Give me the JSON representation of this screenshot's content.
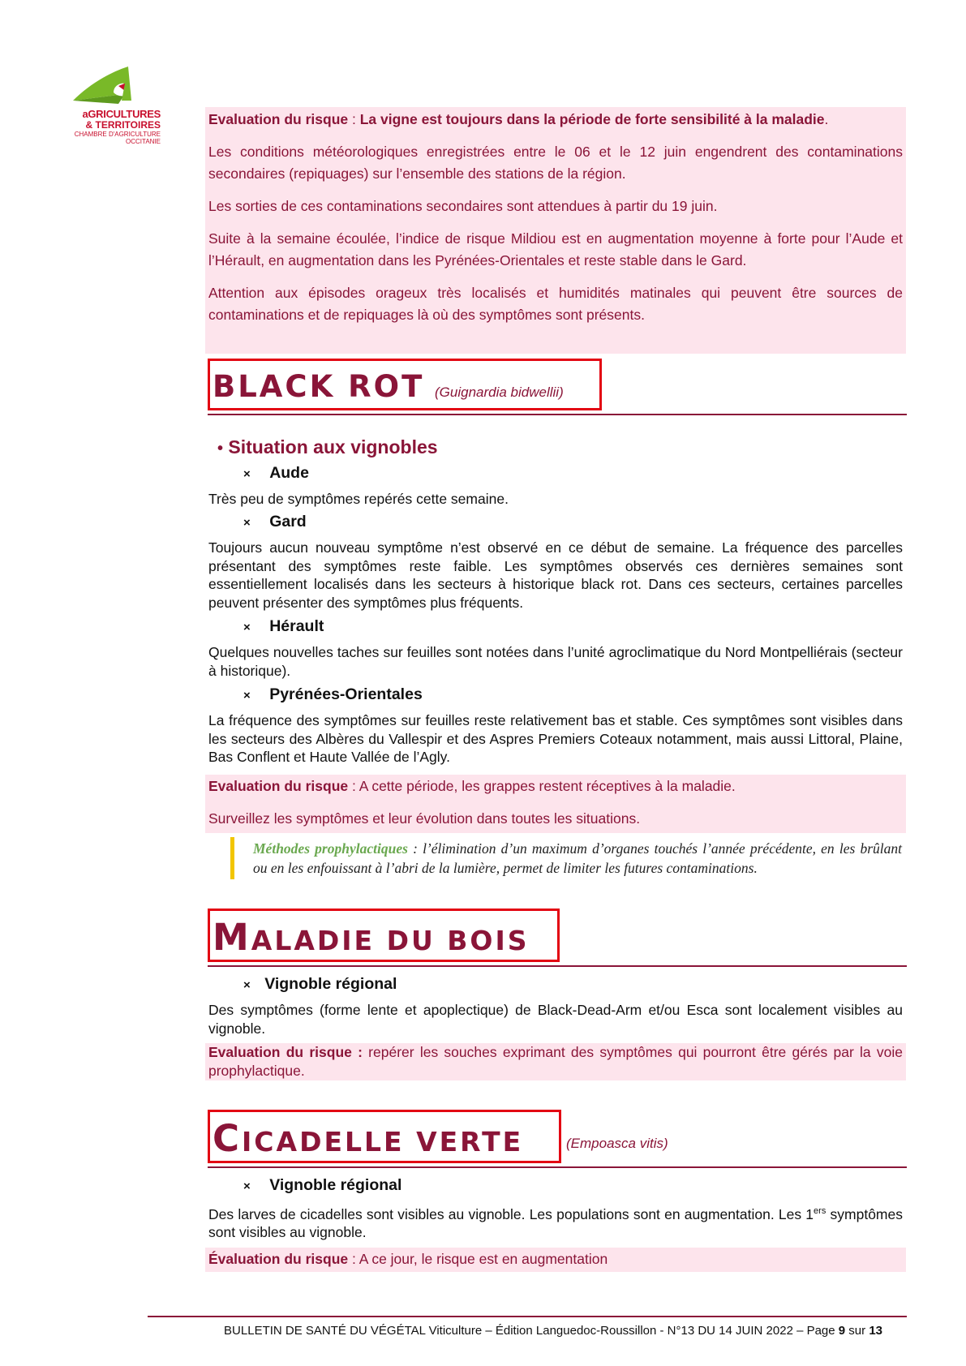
{
  "logo": {
    "line1": "aGRICULTURES",
    "line2": "& TERRITOIRES",
    "line3": "CHAMBRE D'AGRICULTURE",
    "line4": "OCCITANIE",
    "colors": {
      "green": "#79b928",
      "red": "#c8102e"
    }
  },
  "mildiou_eval": {
    "label": "Evaluation du risque",
    "sep": " : ",
    "strong": "La vigne est toujours dans la période de forte sensibilité à la maladie",
    "end": ".",
    "p2": "Les conditions météorologiques enregistrées entre le 06 et le 12 juin engendrent des contaminations secondaires (repiquages) sur l’ensemble des stations de la région.",
    "p3": "Les sorties de ces contaminations secondaires sont attendues à partir du 19 juin.",
    "p4": "Suite à la semaine écoulée, l’indice de risque Mildiou est en augmentation moyenne à forte pour l’Aude et l’Hérault, en augmentation dans les Pyrénées-Orientales et reste stable dans le Gard.",
    "p5": "Attention aux épisodes orageux très localisés et humidités matinales qui peuvent être sources de contaminations et de repiquages là où des symptômes sont présents."
  },
  "black_rot": {
    "title": "BLACK ROT",
    "latin": "(Guignardia bidwellii)",
    "situation": "Situation aux vignobles",
    "bullet": "•",
    "cross": "×",
    "aude": {
      "label": "Aude",
      "text": "Très peu de symptômes repérés cette semaine."
    },
    "gard": {
      "label": "Gard",
      "text": "Toujours aucun nouveau symptôme n’est observé en ce début de semaine. La fréquence des parcelles présentant des symptômes reste faible. Les symptômes observés ces dernières semaines sont essentiellement localisés dans les secteurs à historique black rot. Dans ces secteurs, certaines parcelles peuvent présenter des symptômes plus fréquents."
    },
    "herault": {
      "label": "Hérault",
      "text": "Quelques nouvelles taches sur feuilles sont notées dans l’unité agroclimatique du Nord Montpelliérais (secteur à historique)."
    },
    "po": {
      "label": "Pyrénées-Orientales",
      "text": "La fréquence des symptômes sur feuilles reste relativement bas et stable. Ces symptômes sont visibles dans les secteurs des Albères du Vallespir et des Aspres Premiers Coteaux notamment, mais aussi Littoral, Plaine, Bas Conflent et Haute Vallée de l’Agly."
    },
    "eval_label": "Evaluation du risque",
    "eval_text": " : A cette période, les grappes restent réceptives à la maladie.",
    "eval_p2": "Surveillez les symptômes et leur évolution dans toutes les situations.",
    "methodes_label": "Méthodes prophylactiques",
    "methodes_text": " : l’élimination d’un maximum d’organes touchés l’année précédente, en les brûlant ou en les enfouissant à l’abri de la lumière, permet de limiter les futures contaminations."
  },
  "maladie_bois": {
    "title_cap": "M",
    "title_rest": "ALADIE DU BOIS",
    "cross": "×",
    "sub": "Vignoble régional",
    "text": "Des symptômes (forme lente et apoplectique) de Black-Dead-Arm et/ou Esca sont localement visibles au vignoble.",
    "eval_label": "Evaluation du risque :",
    "eval_text": " repérer les souches exprimant des symptômes qui pourront être gérés par la voie prophylactique."
  },
  "cicadelle": {
    "title_cap": "C",
    "title_rest": "ICADELLE VERTE",
    "latin": "(Empoasca vitis)",
    "cross": "×",
    "sub": "Vignoble régional",
    "text1": "Des larves de cicadelles sont visibles au vignoble. Les populations sont en augmentation. Les 1",
    "sup": "ers",
    "text2": " symptômes sont visibles au vignoble.",
    "eval_label": "Évaluation du risque",
    "eval_text": " : A ce jour, le risque est en augmentation"
  },
  "footer": {
    "text": "BULLETIN DE SANTÉ DU VÉGÉTAL Viticulture – Édition Languedoc-Roussillon - N°13 DU 14 JUIN 2022 – Page ",
    "page": "9",
    "sur": " sur ",
    "total": "13"
  }
}
